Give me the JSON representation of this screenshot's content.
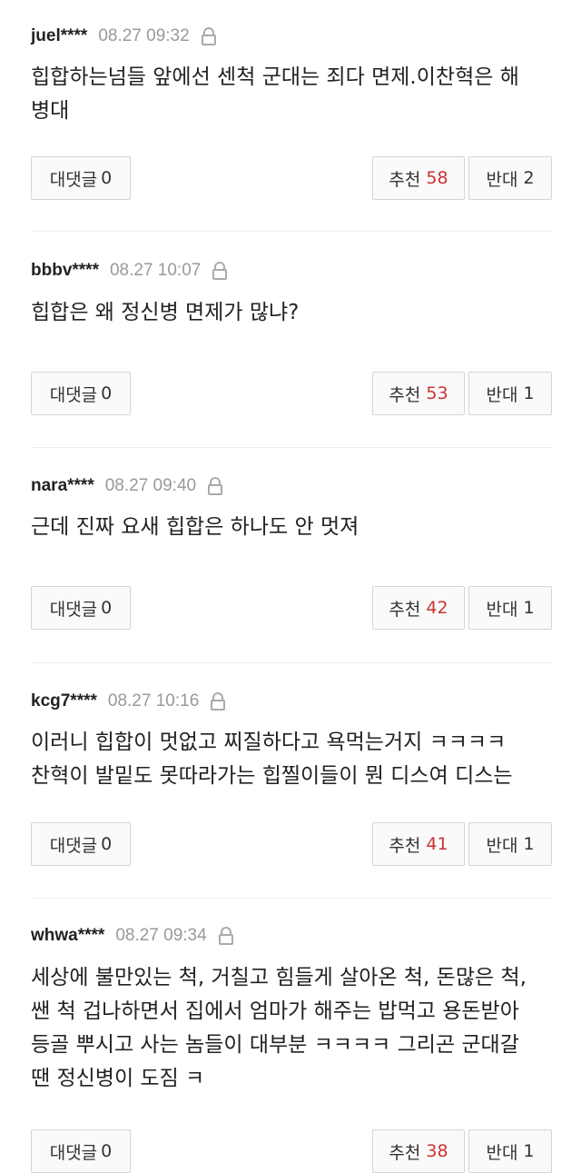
{
  "comments": [
    {
      "user": "juel****",
      "date": "08.27 09:32",
      "text": "힙합하는넘들 앞에선 센척 군대는 죄다 면제.이찬혁은 해\n병대",
      "reply_label": "대댓글",
      "reply_count": "0",
      "up_label": "추천",
      "up_count": "58",
      "down_label": "반대",
      "down_count": "2"
    },
    {
      "user": "bbbv****",
      "date": "08.27 10:07",
      "text": "힙합은 왜 정신병 면제가 많냐?",
      "reply_label": "대댓글",
      "reply_count": "0",
      "up_label": "추천",
      "up_count": "53",
      "down_label": "반대",
      "down_count": "1"
    },
    {
      "user": "nara****",
      "date": "08.27 09:40",
      "text": "근데 진짜 요새 힙합은 하나도 안 멋져",
      "reply_label": "대댓글",
      "reply_count": "0",
      "up_label": "추천",
      "up_count": "42",
      "down_label": "반대",
      "down_count": "1"
    },
    {
      "user": "kcg7****",
      "date": "08.27 10:16",
      "text": "이러니 힙합이 멋없고 찌질하다고 욕먹는거지 ㅋㅋㅋㅋ\n찬혁이 발밑도 못따라가는 힙찔이들이 뭔 디스여 디스는",
      "reply_label": "대댓글",
      "reply_count": "0",
      "up_label": "추천",
      "up_count": "41",
      "down_label": "반대",
      "down_count": "1"
    },
    {
      "user": "whwa****",
      "date": "08.27 09:34",
      "text": "세상에 불만있는 척, 거칠고 힘들게 살아온 척, 돈많은 척,\n쌘 척 겁나하면서 집에서 엄마가 해주는 밥먹고 용돈받아\n등골 뿌시고 사는 놈들이 대부분 ㅋㅋㅋㅋ 그리곤 군대갈\n땐 정신병이 도짐 ㅋ",
      "reply_label": "대댓글",
      "reply_count": "0",
      "up_label": "추천",
      "up_count": "38",
      "down_label": "반대",
      "down_count": "1"
    }
  ],
  "colors": {
    "accent": "#cc3333",
    "meta": "#999999",
    "border": "#d5d5d5"
  },
  "icons": {
    "lock": "lock-icon"
  }
}
